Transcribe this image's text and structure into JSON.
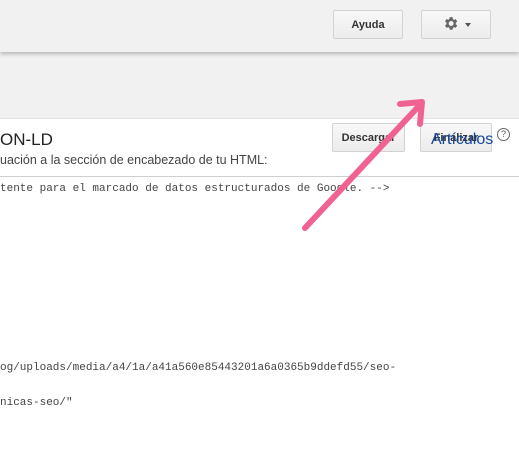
{
  "header": {
    "help_label": "Ayuda",
    "settings_icon": "gear-icon"
  },
  "toolbar": {
    "download_label": "Descargar",
    "finish_label": "Finalizar"
  },
  "content": {
    "title": "ON-LD",
    "subtitle": "uación a la sección de encabezado de tu HTML:",
    "articles_link": "Artículos",
    "help_icon_glyph": "?",
    "code_lines": [
      "tente para el marcado de datos estructurados de Google. -->",
      "og/uploads/media/a4/1a/a41a560e85443201a6a0365b9ddefd55/seo-",
      "nicas-seo/\""
    ]
  },
  "annotation": {
    "arrow_color": "#f06292"
  },
  "colors": {
    "bar_bg": "#f1f1f1",
    "link": "#15459b"
  }
}
